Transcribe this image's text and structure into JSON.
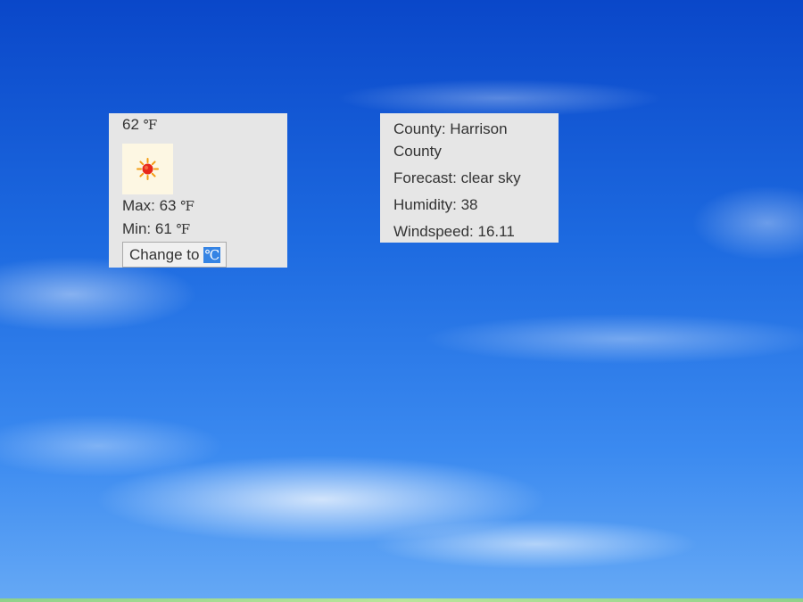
{
  "temperature": {
    "current_value": "62",
    "unit": "℉",
    "max_label": "Max:",
    "max_value": "63",
    "min_label": "Min:",
    "min_value": "61",
    "weather_icon": "sun-icon",
    "change_button": {
      "label": "Change to",
      "target_unit": "℃"
    }
  },
  "details": {
    "county": "County: Harrison County",
    "forecast": "Forecast: clear sky",
    "humidity": "Humidity: 38",
    "windspeed": "Windspeed: 16.11"
  },
  "colors": {
    "panel_bg": "#e6e6e6",
    "sky_top": "#0a47c9",
    "selection": "#3584e4"
  }
}
